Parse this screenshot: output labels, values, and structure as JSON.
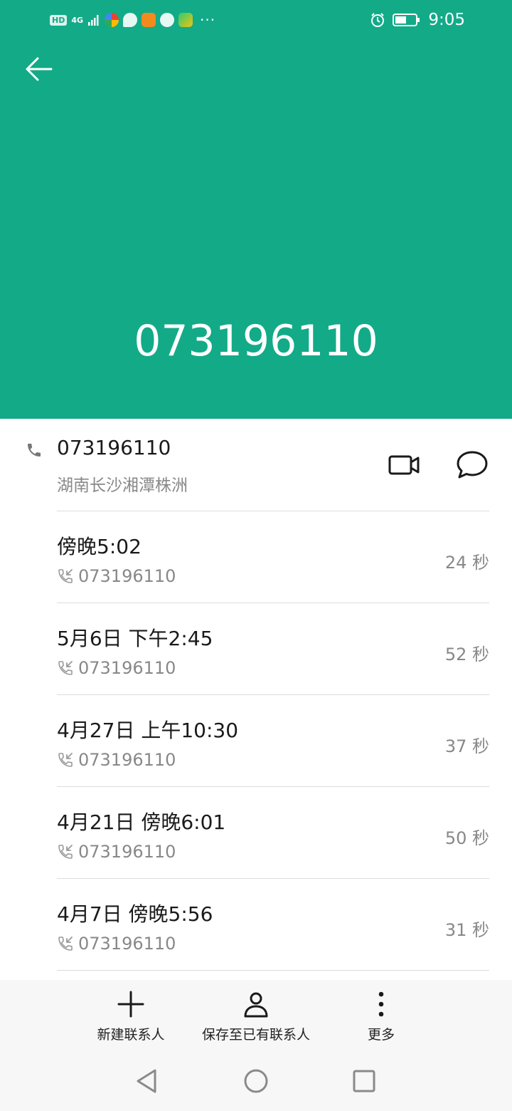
{
  "status_bar": {
    "hd_label": "HD",
    "network_label": "4G",
    "time": "9:05"
  },
  "header": {
    "number": "073196110",
    "background_color": "#13aa88"
  },
  "contact": {
    "number": "073196110",
    "location": "湖南长沙湘潭株洲"
  },
  "calls": [
    {
      "time": "傍晚5:02",
      "number": "073196110",
      "duration": "24 秒"
    },
    {
      "time": "5月6日 下午2:45",
      "number": "073196110",
      "duration": "52 秒"
    },
    {
      "time": "4月27日 上午10:30",
      "number": "073196110",
      "duration": "37 秒"
    },
    {
      "time": "4月21日 傍晚6:01",
      "number": "073196110",
      "duration": "50 秒"
    },
    {
      "time": "4月7日 傍晚5:56",
      "number": "073196110",
      "duration": "31 秒"
    }
  ],
  "actions": {
    "new_contact": "新建联系人",
    "save_existing": "保存至已有联系人",
    "more": "更多"
  }
}
